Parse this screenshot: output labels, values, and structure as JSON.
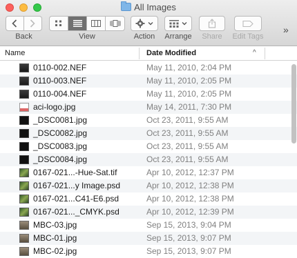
{
  "window": {
    "title": "All Images"
  },
  "toolbar": {
    "back_label": "Back",
    "view_label": "View",
    "action_label": "Action",
    "arrange_label": "Arrange",
    "share_label": "Share",
    "edit_tags_label": "Edit Tags",
    "overflow_glyph": "»"
  },
  "columns": {
    "name": "Name",
    "date_modified": "Date Modified"
  },
  "files": [
    {
      "name": "0110-002.NEF",
      "date": "May 11, 2010, 2:04 PM",
      "thumb": "raw"
    },
    {
      "name": "0110-003.NEF",
      "date": "May 11, 2010, 2:05 PM",
      "thumb": "raw"
    },
    {
      "name": "0110-004.NEF",
      "date": "May 11, 2010, 2:05 PM",
      "thumb": "raw"
    },
    {
      "name": "aci-logo.jpg",
      "date": "May 14, 2011, 7:30 PM",
      "thumb": "logo"
    },
    {
      "name": "_DSC0081.jpg",
      "date": "Oct 23, 2011, 9:55 AM",
      "thumb": "dark-photo"
    },
    {
      "name": "_DSC0082.jpg",
      "date": "Oct 23, 2011, 9:55 AM",
      "thumb": "dark-photo"
    },
    {
      "name": "_DSC0083.jpg",
      "date": "Oct 23, 2011, 9:55 AM",
      "thumb": "dark-photo"
    },
    {
      "name": "_DSC0084.jpg",
      "date": "Oct 23, 2011, 9:55 AM",
      "thumb": "dark-photo"
    },
    {
      "name": "0167-021...-Hue-Sat.tif",
      "date": "Apr 10, 2012, 12:37 PM",
      "thumb": "green-photo"
    },
    {
      "name": "0167-021...y Image.psd",
      "date": "Apr 10, 2012, 12:38 PM",
      "thumb": "green-photo"
    },
    {
      "name": "0167-021...C41-E6.psd",
      "date": "Apr 10, 2012, 12:38 PM",
      "thumb": "green-photo"
    },
    {
      "name": "0167-021..._CMYK.psd",
      "date": "Apr 10, 2012, 12:39 PM",
      "thumb": "green-photo"
    },
    {
      "name": "MBC-03.jpg",
      "date": "Sep 15, 2013, 9:04 PM",
      "thumb": "mbc-photo"
    },
    {
      "name": "MBC-01.jpg",
      "date": "Sep 15, 2013, 9:07 PM",
      "thumb": "mbc-photo"
    },
    {
      "name": "MBC-02.jpg",
      "date": "Sep 15, 2013, 9:07 PM",
      "thumb": "mbc-photo"
    }
  ],
  "colors": {
    "row_alt": "#f3f5f7",
    "date_text": "#808080",
    "view_selected": "#707070"
  }
}
